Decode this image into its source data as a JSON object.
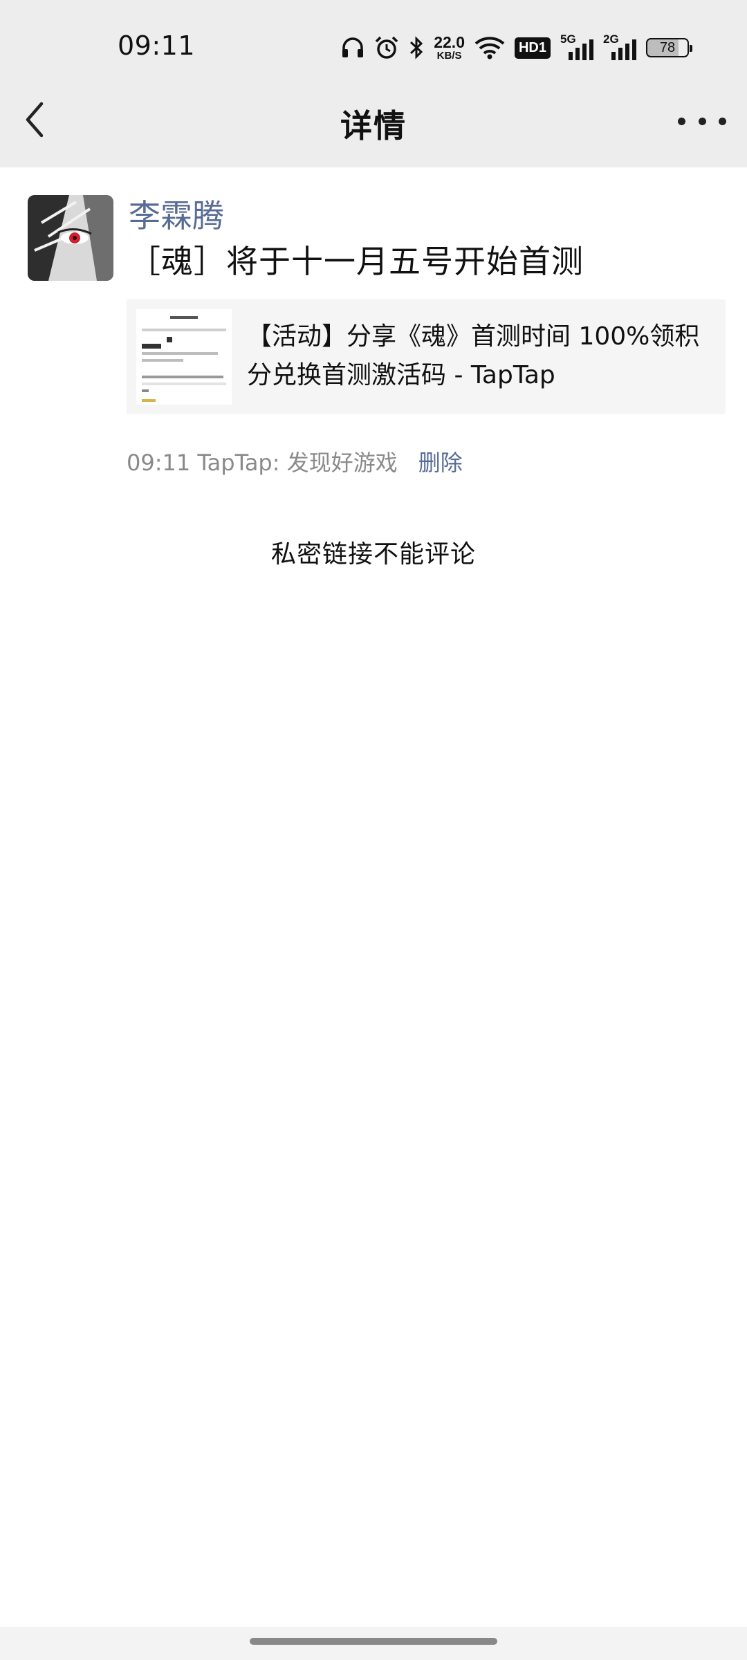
{
  "status_bar": {
    "time": "09:11",
    "net_speed_value": "22.0",
    "net_speed_unit": "KB/S",
    "hd_label": "HD1",
    "signal_1_label": "5G",
    "signal_2_label": "2G",
    "battery_level": "78",
    "icons": [
      "headphones-icon",
      "alarm-icon",
      "bluetooth-icon",
      "wifi-icon"
    ]
  },
  "nav": {
    "title": "详情",
    "back_icon": "chevron-left-icon",
    "more_icon": "more-icon"
  },
  "post": {
    "username": "李霖腾",
    "text": "［魂］将于十一月五号开始首测",
    "link_card": {
      "title": "【活动】分享《魂》首测时间 100%领积分兑换首测激活码 - TapTap"
    },
    "time": "09:11",
    "source": "TapTap: 发现好游戏",
    "delete_label": "删除"
  },
  "comments": {
    "notice": "私密链接不能评论"
  },
  "colors": {
    "link_blue": "#576b95",
    "header_bg": "#ededed",
    "card_bg": "#f5f5f5"
  }
}
